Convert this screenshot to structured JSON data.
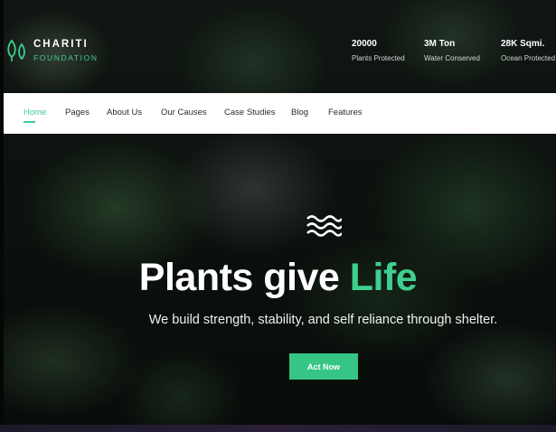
{
  "brand": {
    "name": "CHARITI",
    "subtitle": "FOUNDATION",
    "accent_color": "#3fcf8e",
    "logo_icon": "leaf-icon"
  },
  "stats": [
    {
      "value": "20000",
      "label": "Plants Protected"
    },
    {
      "value": "3M Ton",
      "label": "Water Conserved"
    },
    {
      "value": "28K Sqmi.",
      "label": "Ocean Protected"
    }
  ],
  "nav": {
    "items": [
      {
        "label": "Home",
        "active": true
      },
      {
        "label": "Pages"
      },
      {
        "label": "About Us"
      },
      {
        "label": "Our Causes"
      },
      {
        "label": "Case Studies"
      },
      {
        "label": "Blog"
      },
      {
        "label": "Features"
      }
    ]
  },
  "hero": {
    "icon": "waves-icon",
    "title_main": "Plants give ",
    "title_accent": "Life",
    "subtitle": "We build strength, stability, and self reliance through shelter.",
    "cta_label": "Act Now"
  }
}
